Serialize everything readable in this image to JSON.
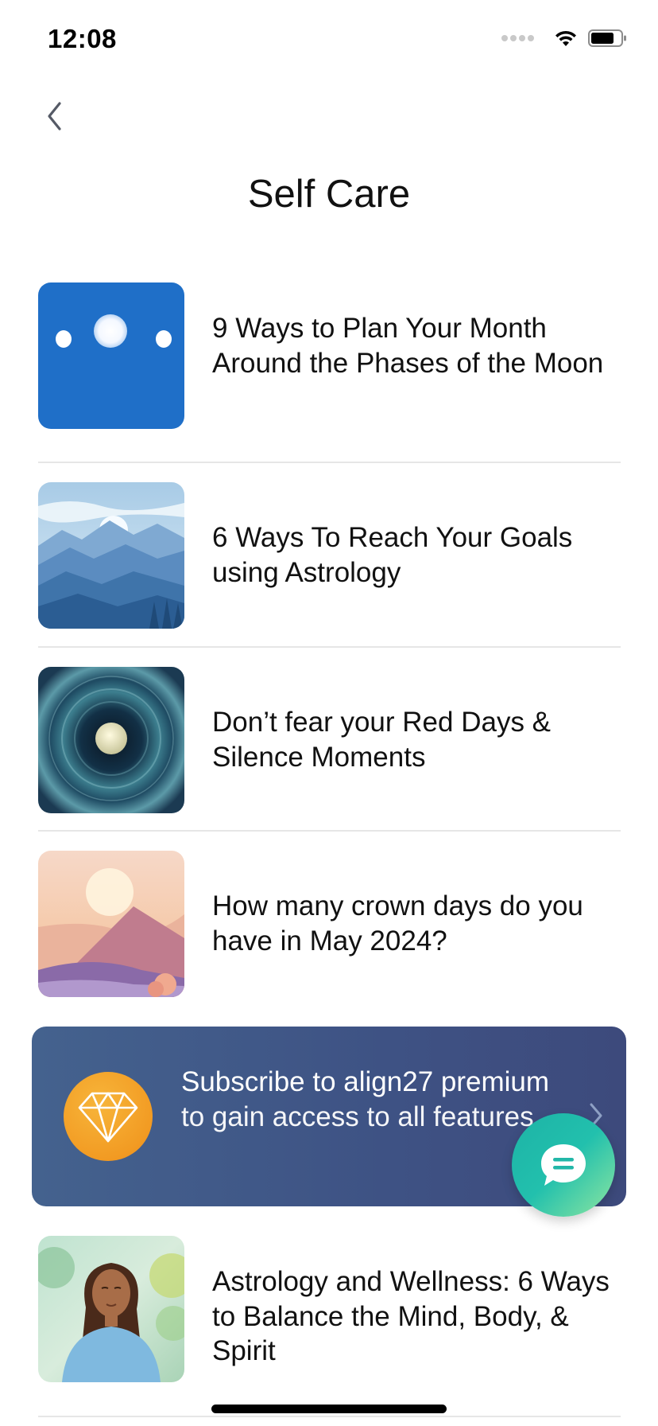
{
  "status_bar": {
    "time": "12:08"
  },
  "header": {
    "title": "Self Care"
  },
  "articles": [
    {
      "title": "9 Ways to Plan Your Month Around the Phases of the Moon"
    },
    {
      "title": "6 Ways To Reach Your Goals using Astrology"
    },
    {
      "title": "Don’t fear your Red Days & Silence Moments"
    },
    {
      "title": "How many crown days do you have in May 2024?"
    },
    {
      "title": "Astrology and Wellness: 6 Ways to Balance the Mind, Body, & Spirit"
    }
  ],
  "promo": {
    "highlight": "Subscribe to align27 premium",
    "rest": " to gain access to all features"
  },
  "colors": {
    "promo_bg": "#3e5284",
    "gem": "#f29b23",
    "fab": "#22c0ad",
    "moon_thumb": "#1f6fc8"
  },
  "icons": [
    "back-chevron-icon",
    "diamond-icon",
    "chevron-right-icon",
    "chat-bubble-icon",
    "wifi-icon",
    "battery-icon"
  ]
}
